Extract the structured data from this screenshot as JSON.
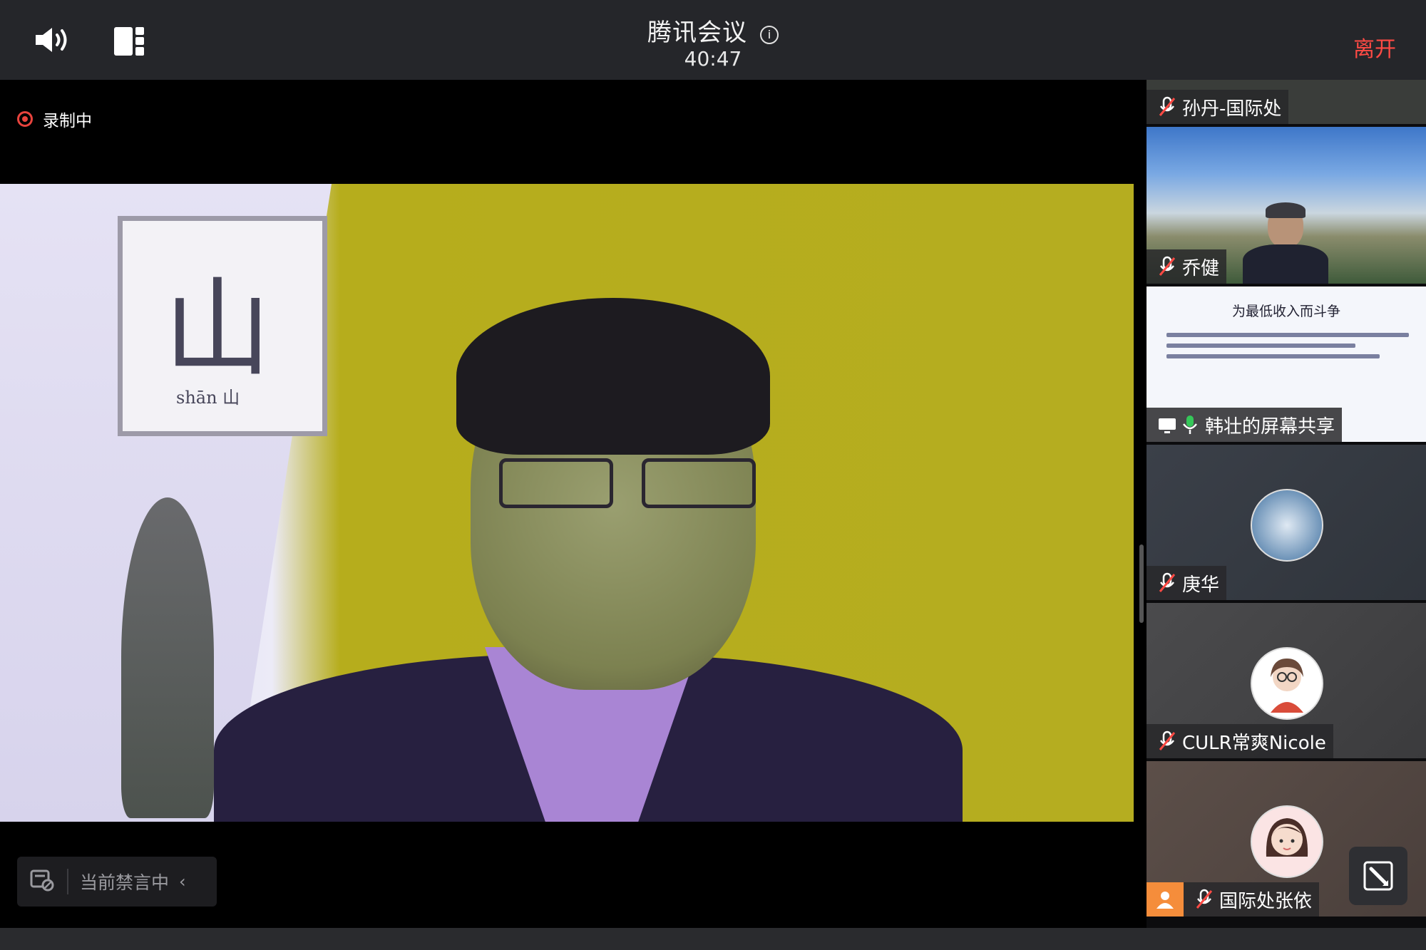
{
  "topbar": {
    "title": "腾讯会议",
    "timer": "40:47",
    "leave_label": "离开"
  },
  "main": {
    "recording_label": "录制中",
    "muted_label": "当前禁言中",
    "frame_calligraphy": "山",
    "frame_caption": "shān   山"
  },
  "participants": [
    {
      "name": "孙丹-国际处",
      "mic": "muted"
    },
    {
      "name": "乔健",
      "mic": "muted"
    },
    {
      "name": "韩壮的屏幕共享",
      "mic": "active",
      "screen_share": true
    },
    {
      "name": "庚华",
      "mic": "muted"
    },
    {
      "name": "CULR常爽Nicole",
      "mic": "muted"
    },
    {
      "name": "国际处张依",
      "mic": "muted"
    }
  ],
  "shared_slide": {
    "title": "为最低收入而斗争"
  },
  "colors": {
    "leave": "#ff4a44",
    "recording": "#e8433d",
    "active_mic": "#35c759",
    "badge": "#f58d3b"
  }
}
